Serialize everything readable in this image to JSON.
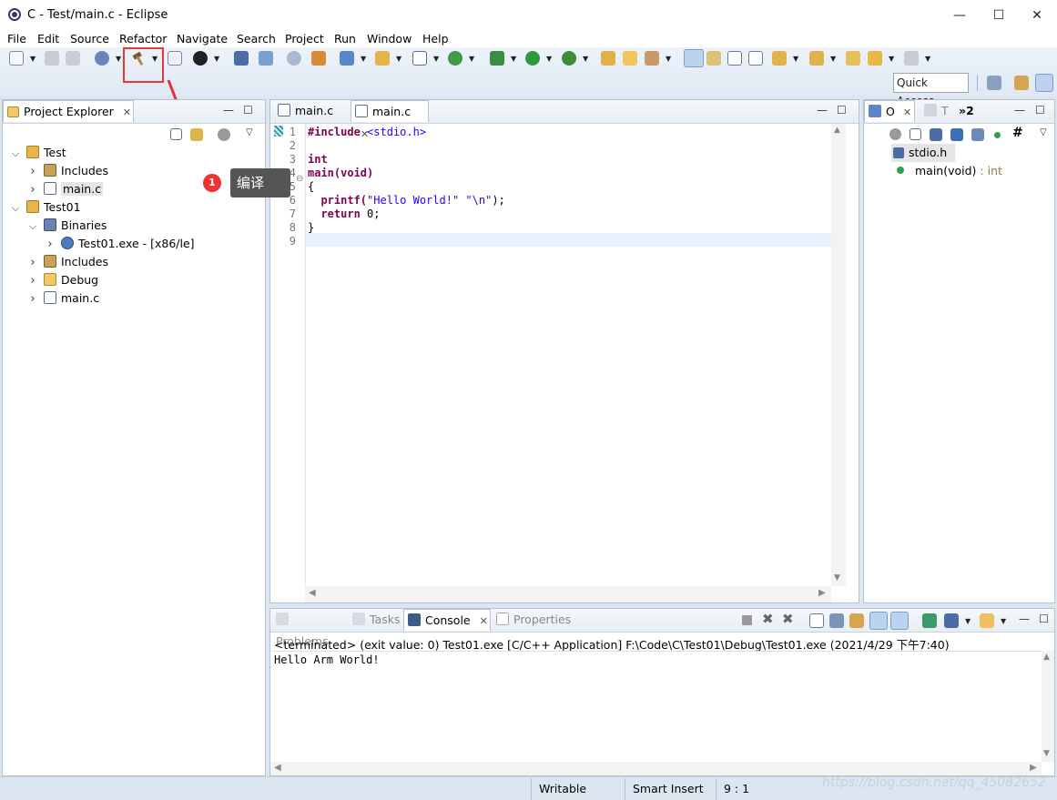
{
  "window": {
    "title": "C - Test/main.c - Eclipse"
  },
  "menu": [
    "File",
    "Edit",
    "Source",
    "Refactor",
    "Navigate",
    "Search",
    "Project",
    "Run",
    "Window",
    "Help"
  ],
  "toolbar": {
    "quick_access": "Quick Access"
  },
  "project_explorer": {
    "title": "Project Explorer",
    "tree": [
      {
        "label": "Test",
        "level": 0,
        "twisty": "open",
        "icon": "project"
      },
      {
        "label": "Includes",
        "level": 1,
        "twisty": "closed",
        "icon": "includes"
      },
      {
        "label": "main.c",
        "level": 1,
        "twisty": "closed",
        "icon": "c-file",
        "selected": true
      },
      {
        "label": "Test01",
        "level": 0,
        "twisty": "open",
        "icon": "project"
      },
      {
        "label": "Binaries",
        "level": 1,
        "twisty": "open",
        "icon": "binaries"
      },
      {
        "label": "Test01.exe - [x86/le]",
        "level": 2,
        "twisty": "closed",
        "icon": "exe"
      },
      {
        "label": "Includes",
        "level": 1,
        "twisty": "closed",
        "icon": "includes"
      },
      {
        "label": "Debug",
        "level": 1,
        "twisty": "closed",
        "icon": "folder"
      },
      {
        "label": "main.c",
        "level": 1,
        "twisty": "closed",
        "icon": "c-file"
      }
    ]
  },
  "editor": {
    "tabs": [
      {
        "label": "main.c",
        "active": false
      },
      {
        "label": "main.c",
        "active": true
      }
    ],
    "lines": [
      "1",
      "2",
      "3",
      "4",
      "5",
      "6",
      "7",
      "8",
      "9"
    ],
    "code": {
      "l1_kw": "#include",
      "l1_inc": " <stdio.h>",
      "l3": "int",
      "l4": "main(void)",
      "l5": "{",
      "l6_a": "  printf(",
      "l6_s1": "\"Hello World!\"",
      "l6_b": " ",
      "l6_s2": "\"\\n\"",
      "l6_c": ");",
      "l7_a": "  ",
      "l7_kw": "return",
      "l7_b": " 0;",
      "l8": "}"
    }
  },
  "outline": {
    "tabs": [
      {
        "label": "O"
      },
      {
        "label": "T"
      },
      {
        "label": "»2"
      }
    ],
    "items": [
      {
        "label": "stdio.h",
        "type": "include",
        "selected": true
      },
      {
        "label": "main(void)",
        "suffix": " : int",
        "type": "function"
      }
    ]
  },
  "console": {
    "tabs": [
      {
        "label": "Problems"
      },
      {
        "label": "Tasks"
      },
      {
        "label": "Console",
        "active": true
      },
      {
        "label": "Properties"
      }
    ],
    "status": "<terminated> (exit value: 0) Test01.exe [C/C++ Application] F:\\Code\\C\\Test01\\Debug\\Test01.exe (2021/4/29 下午7:40)",
    "output": "Hello Arm World!"
  },
  "statusbar": {
    "writable": "Writable",
    "insert_mode": "Smart Insert",
    "position": "9 : 1"
  },
  "annotation": {
    "badge": "1",
    "tooltip": "编译"
  },
  "watermark": "https://blog.csdn.net/qq_45082652",
  "colors": {
    "highlight_box": "#e03b3b",
    "keyword": "#7f0055",
    "string": "#2a00ff",
    "badge": "#e33333"
  }
}
